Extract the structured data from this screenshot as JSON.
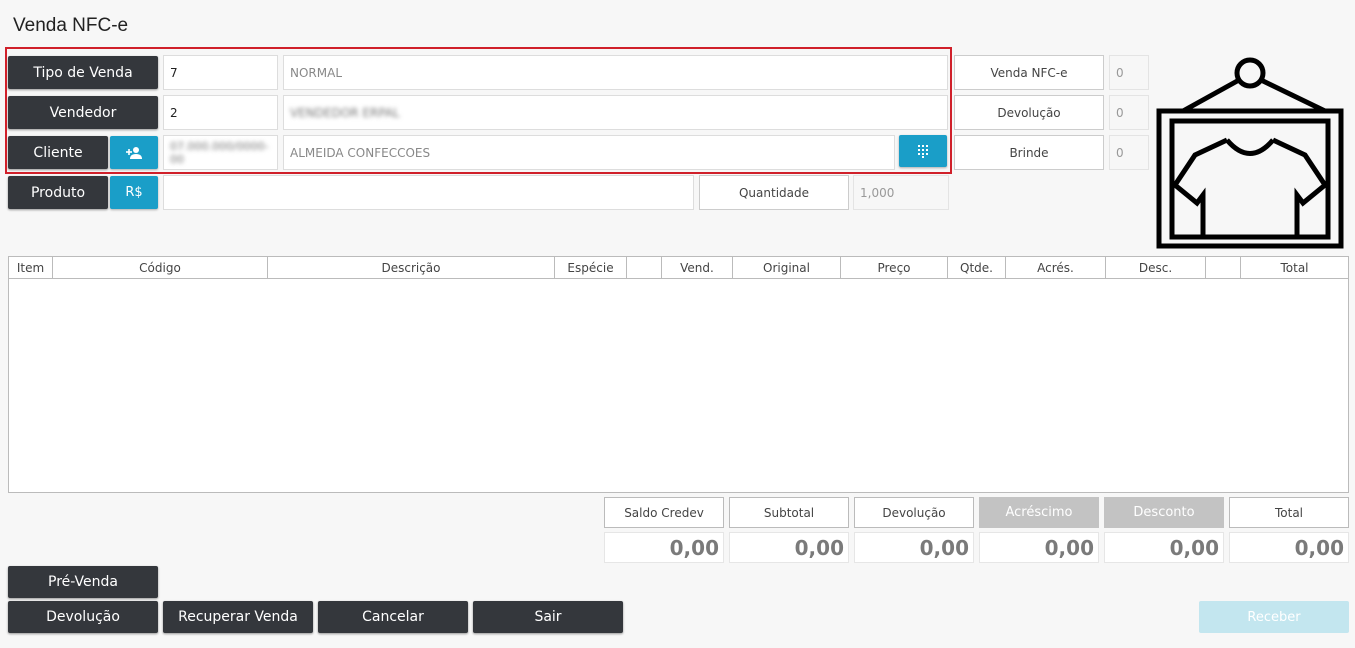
{
  "page_title": "Venda NFC-e",
  "form": {
    "tipo_venda_label": "Tipo de Venda",
    "tipo_venda_code": "7",
    "tipo_venda_desc": "NORMAL",
    "vendedor_label": "Vendedor",
    "vendedor_code": "2",
    "vendedor_name": "VENDEDOR ERPAL",
    "cliente_label": "Cliente",
    "cliente_code": "07.000.000/0000-00",
    "cliente_name": "ALMEIDA CONFECCOES",
    "produto_label": "Produto",
    "produto_price_icon": "R$",
    "produto_value": "",
    "quantidade_label": "Quantidade",
    "quantidade_value": "1,000"
  },
  "right_info": {
    "venda_nfce_label": "Venda NFC-e",
    "venda_nfce_value": "0",
    "devolucao_label": "Devolução",
    "devolucao_value": "0",
    "brinde_label": "Brinde",
    "brinde_value": "0"
  },
  "icons": {
    "add_client": "add-person-icon",
    "keypad": "keypad-icon",
    "logo": "clothing-store-icon"
  },
  "grid": {
    "columns": [
      "Item",
      "Código",
      "Descrição",
      "Espécie",
      "",
      "Vend.",
      "Original",
      "Preço",
      "Qtde.",
      "Acrés.",
      "Desc.",
      "",
      "Total"
    ]
  },
  "totals": {
    "labels": [
      "Saldo Credev",
      "Subtotal",
      "Devolução",
      "Acréscimo",
      "Desconto",
      "Total"
    ],
    "values": [
      "0,00",
      "0,00",
      "0,00",
      "0,00",
      "0,00",
      "0,00"
    ]
  },
  "actions": {
    "pre_venda": "Pré-Venda",
    "devolucao": "Devolução",
    "recuperar": "Recuperar Venda",
    "cancelar": "Cancelar",
    "sair": "Sair",
    "receber": "Receber"
  },
  "colors": {
    "dark_button": "#34373c",
    "accent_blue": "#1a9ec8",
    "highlight_red": "#d0202a"
  }
}
